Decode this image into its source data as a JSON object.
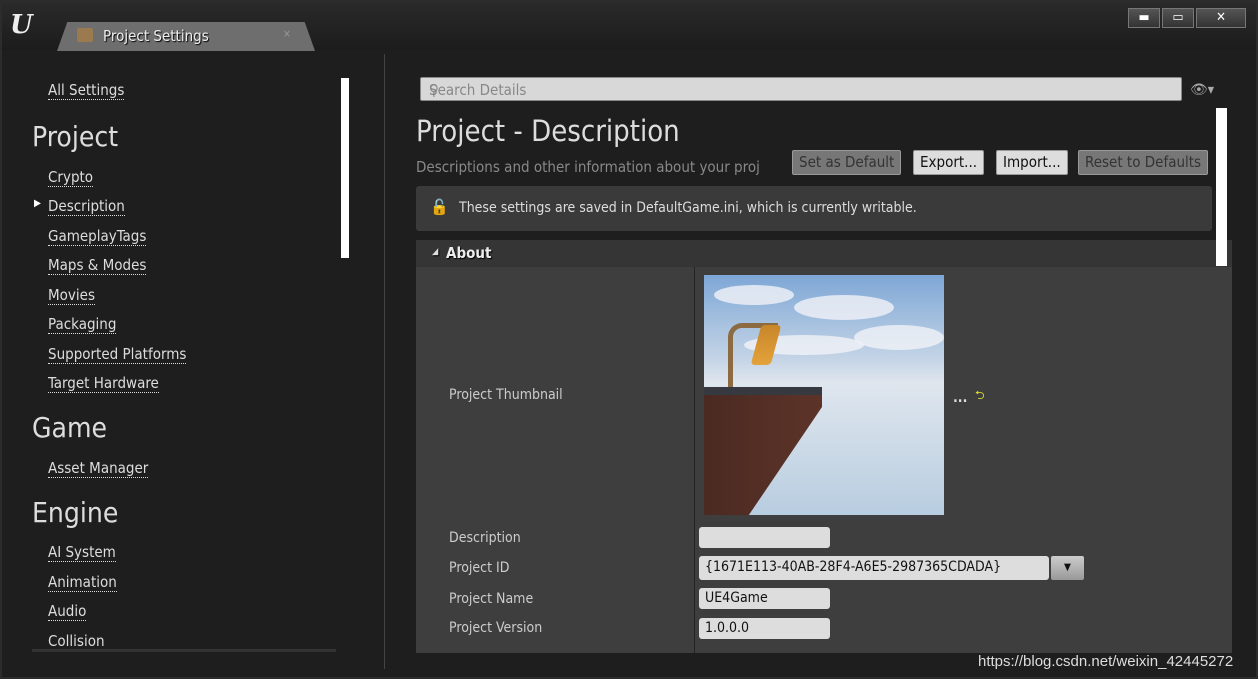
{
  "window": {
    "tab_title": "Project Settings",
    "tab_close": "×",
    "controls": {
      "minimize": "▬",
      "maximize": "▭",
      "close": "✕"
    },
    "logo": "U"
  },
  "sidebar": {
    "all_settings": "All Settings",
    "categories": [
      {
        "title": "Project",
        "items": [
          "Crypto",
          "Description",
          "GameplayTags",
          "Maps & Modes",
          "Movies",
          "Packaging",
          "Supported Platforms",
          "Target Hardware"
        ]
      },
      {
        "title": "Game",
        "items": [
          "Asset Manager"
        ]
      },
      {
        "title": "Engine",
        "items": [
          "AI System",
          "Animation",
          "Audio",
          "Collision"
        ]
      }
    ],
    "selected": "Description"
  },
  "search": {
    "placeholder": "Search Details"
  },
  "header": {
    "title": "Project - Description",
    "subtitle": "Descriptions and other information about your proj"
  },
  "buttons": {
    "set_default": "Set as Default",
    "export": "Export...",
    "import": "Import...",
    "reset": "Reset to Defaults"
  },
  "notice": "These settings are saved in DefaultGame.ini, which is currently writable.",
  "section": {
    "title": "About"
  },
  "properties": {
    "thumbnail_label": "Project Thumbnail",
    "thumbnail_browse": "...",
    "thumbnail_reset": "⮌",
    "description_label": "Description",
    "description_value": "",
    "id_label": "Project ID",
    "id_value": "{1671E113-40AB-28F4-A6E5-2987365CDADA}",
    "name_label": "Project Name",
    "name_value": "UE4Game",
    "version_label": "Project Version",
    "version_value": "1.0.0.0"
  },
  "watermark": "https://blog.csdn.net/weixin_42445272",
  "colors": {
    "background": "#1e1e1e",
    "panel": "#3e3e3e",
    "reset_arrow": "#dede2c"
  }
}
